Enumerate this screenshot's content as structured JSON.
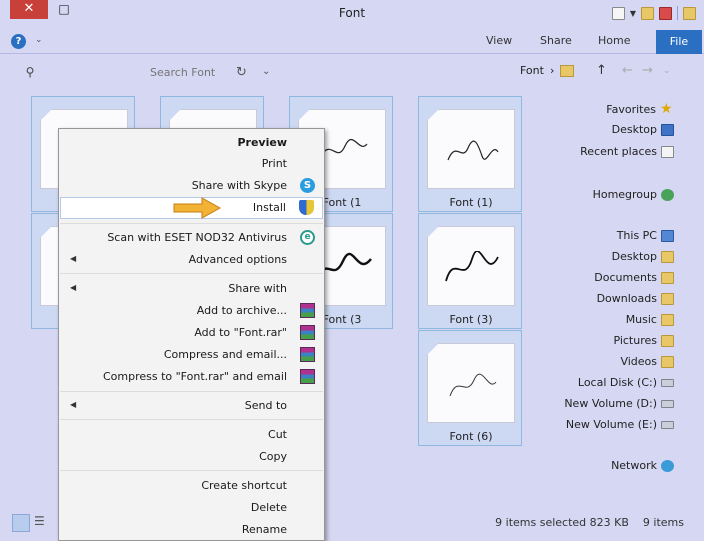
{
  "window": {
    "title": "Font",
    "close_glyph": "✕",
    "maximize_glyph": "□"
  },
  "ribbon": {
    "tabs": [
      {
        "label": "File"
      },
      {
        "label": "Home"
      },
      {
        "label": "Share"
      },
      {
        "label": "View"
      }
    ],
    "help_glyph": "?"
  },
  "address": {
    "path": "Font",
    "search_placeholder": "Search Font"
  },
  "nav": {
    "favorites": "Favorites",
    "desktop": "Desktop",
    "recent_places": "Recent places",
    "homegroup": "Homegroup",
    "this_pc": "This PC",
    "pc_desktop": "Desktop",
    "documents": "Documents",
    "downloads": "Downloads",
    "music": "Music",
    "pictures": "Pictures",
    "videos": "Videos",
    "local_disk": "Local Disk (C:)",
    "new_volume_d": "New Volume (D:)",
    "new_volume_e": "New Volume (E:)",
    "network": "Network"
  },
  "tiles": [
    {
      "label": "Font (1)"
    },
    {
      "label": "Font (1"
    },
    {
      "label": "Font (3)"
    },
    {
      "label": "Font (3"
    },
    {
      "label": "Font (6)"
    }
  ],
  "context_menu": {
    "preview": "Preview",
    "print": "Print",
    "share_skype": "Share with Skype",
    "install": "Install",
    "scan_eset": "Scan with ESET NOD32 Antivirus",
    "advanced_options": "Advanced options",
    "share_with": "Share with",
    "add_archive": "Add to archive...",
    "add_font_rar": "Add to \"Font.rar\"",
    "compress_email": "Compress and email...",
    "compress_font_email": "Compress to \"Font.rar\" and email",
    "send_to": "Send to",
    "cut": "Cut",
    "copy": "Copy",
    "create_shortcut": "Create shortcut",
    "delete": "Delete",
    "rename": "Rename"
  },
  "status": {
    "items_count": "9 items",
    "selection": "9 items selected  823 KB"
  },
  "colors": {
    "accent": "#2b6fc2",
    "close_red": "#c9403a",
    "window_bg": "#d6d7f3",
    "selection_border": "#8fb8e0",
    "arrow_annotation": "#f2b233"
  }
}
